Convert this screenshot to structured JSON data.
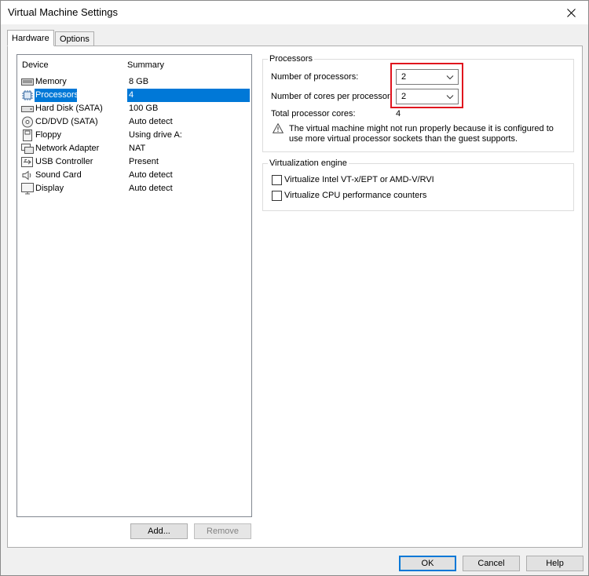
{
  "window": {
    "title": "Virtual Machine Settings"
  },
  "tabs": [
    {
      "label": "Hardware",
      "active": true
    },
    {
      "label": "Options",
      "active": false
    }
  ],
  "device_list": {
    "columns": [
      "Device",
      "Summary"
    ],
    "items": [
      {
        "name": "Memory",
        "summary": "8 GB",
        "icon": "memory-icon"
      },
      {
        "name": "Processors",
        "summary": "4",
        "icon": "processor-icon",
        "selected": true
      },
      {
        "name": "Hard Disk (SATA)",
        "summary": "100 GB",
        "icon": "hard-disk-icon"
      },
      {
        "name": "CD/DVD (SATA)",
        "summary": "Auto detect",
        "icon": "cd-dvd-icon"
      },
      {
        "name": "Floppy",
        "summary": "Using drive A:",
        "icon": "floppy-icon"
      },
      {
        "name": "Network Adapter",
        "summary": "NAT",
        "icon": "network-adapter-icon"
      },
      {
        "name": "USB Controller",
        "summary": "Present",
        "icon": "usb-icon"
      },
      {
        "name": "Sound Card",
        "summary": "Auto detect",
        "icon": "speaker-icon"
      },
      {
        "name": "Display",
        "summary": "Auto detect",
        "icon": "monitor-icon"
      }
    ],
    "add_label": "Add...",
    "remove_label": "Remove"
  },
  "processors": {
    "group_label": "Processors",
    "num_processors_label": "Number of processors:",
    "num_processors_value": "2",
    "cores_label": "Number of cores per processor:",
    "cores_value": "2",
    "total_label": "Total processor cores:",
    "total_value": "4",
    "warning": "The virtual machine might not run properly because it is configured to use more virtual processor sockets than the guest supports."
  },
  "virtualization": {
    "group_label": "Virtualization engine",
    "options": [
      {
        "label": "Virtualize Intel VT-x/EPT or AMD-V/RVI",
        "checked": false
      },
      {
        "label": "Virtualize CPU performance counters",
        "checked": false
      }
    ]
  },
  "footer": {
    "ok_label": "OK",
    "cancel_label": "Cancel",
    "help_label": "Help"
  },
  "colors": {
    "selection": "#0078d7",
    "highlight": "#e0141e"
  }
}
